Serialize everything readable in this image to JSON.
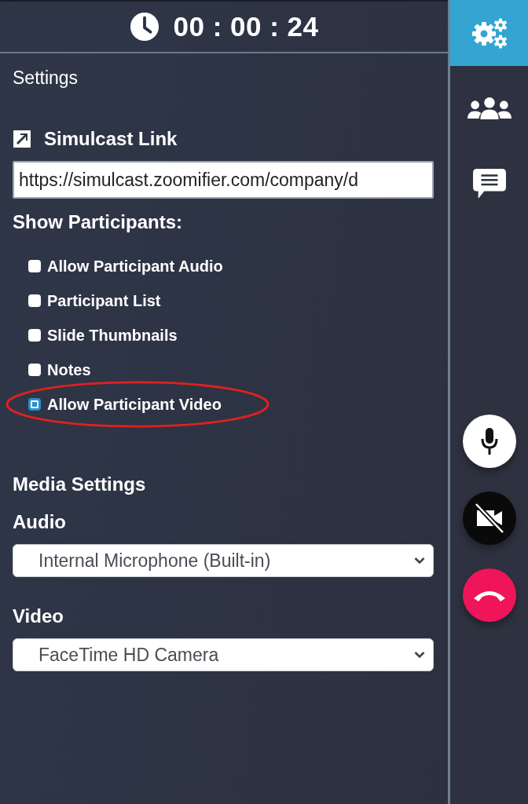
{
  "timer": "00 : 00 : 24",
  "panel_title": "Settings",
  "simulcast": {
    "label": "Simulcast Link",
    "value": "https://simulcast.zoomifier.com/company/d"
  },
  "show_participants": {
    "label": "Show Participants:",
    "options": [
      {
        "label": "Allow Participant Audio",
        "checked": false,
        "circled": false
      },
      {
        "label": "Participant List",
        "checked": false,
        "circled": false
      },
      {
        "label": "Slide Thumbnails",
        "checked": false,
        "circled": false
      },
      {
        "label": "Notes",
        "checked": false,
        "circled": false
      },
      {
        "label": "Allow Participant Video",
        "checked": true,
        "circled": true
      }
    ]
  },
  "media": {
    "title": "Media Settings",
    "fields": [
      {
        "label": "Audio",
        "value": "Internal Microphone (Built-in)"
      },
      {
        "label": "Video",
        "value": "FaceTime HD Camera"
      }
    ]
  },
  "sidebar_tabs": [
    {
      "kind": "settings",
      "selected": true
    },
    {
      "kind": "participants",
      "selected": false
    },
    {
      "kind": "chat",
      "selected": false
    }
  ],
  "call_controls": [
    {
      "kind": "microphone",
      "on": true
    },
    {
      "kind": "camera",
      "on": false
    },
    {
      "kind": "hang-up"
    }
  ]
}
